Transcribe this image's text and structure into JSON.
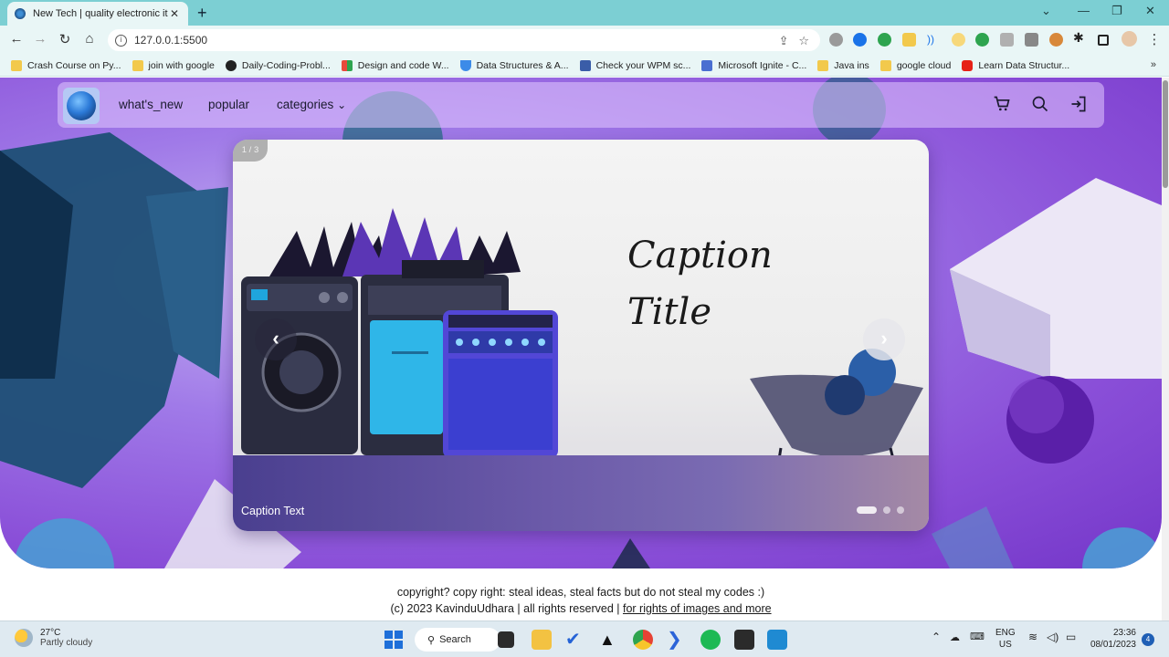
{
  "browser": {
    "tab_title": "New Tech | quality electronic item",
    "tab_close": "✕",
    "new_tab": "+",
    "url": "127.0.0.1:5500",
    "bookmarks": [
      {
        "label": "Crash Course on Py...",
        "color": "#f2c94c"
      },
      {
        "label": "join with google",
        "color": "#f2c94c"
      },
      {
        "label": "Daily-Coding-Probl...",
        "color": "#222222"
      },
      {
        "label": "Design and code W...",
        "color": "#e84a3c"
      },
      {
        "label": "Data Structures & A...",
        "color": "#3c8be8"
      },
      {
        "label": "Check your WPM sc...",
        "color": "#3a5da8"
      },
      {
        "label": "Microsoft Ignite - C...",
        "color": "#4a6fd1"
      },
      {
        "label": "Java ins",
        "color": "#f2c94c"
      },
      {
        "label": "google cloud",
        "color": "#f2c94c"
      },
      {
        "label": "Learn Data Structur...",
        "color": "#e62117"
      }
    ],
    "bookmarks_more": "»"
  },
  "nav": {
    "links": [
      "what's_new",
      "popular",
      "categories"
    ],
    "categories_chevron": "⌄"
  },
  "carousel": {
    "counter": "1 / 3",
    "caption_title_line1": "Caption",
    "caption_title_line2": "Title",
    "caption_text": "Caption Text",
    "prev_arrow": "‹",
    "next_arrow": "›",
    "active_index": 0,
    "total_slides": 3
  },
  "footer": {
    "line1": "copyright? copy right: steal ideas, steal facts but do not steal my codes :)",
    "line2_prefix": "(c) 2023 KavinduUdhara | all rights reserved |",
    "line2_link": "for rights of images and more"
  },
  "taskbar": {
    "temperature": "27°C",
    "weather": "Partly cloudy",
    "search_label": "Search",
    "language_1": "ENG",
    "language_2": "US",
    "time": "23:36",
    "date": "08/01/2023",
    "notifications": "4"
  },
  "colors": {
    "accent": "#8a4fd8",
    "chrome": "#7ccfd3"
  }
}
